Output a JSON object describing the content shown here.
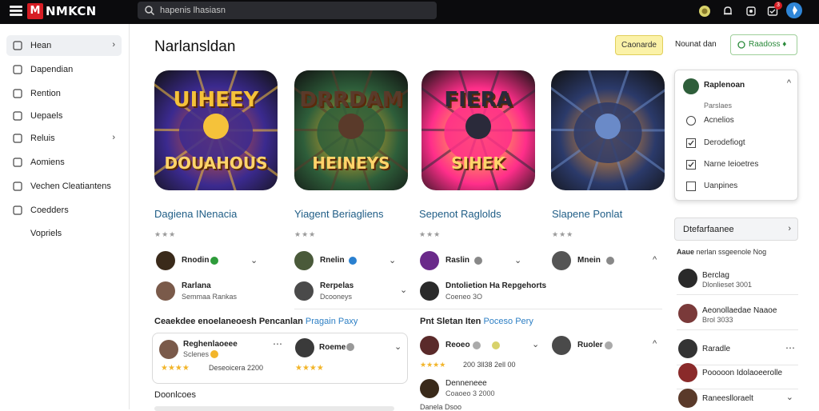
{
  "app": {
    "logo_badge": "M",
    "logo_text": "NMKCN"
  },
  "search": {
    "text": "hapenis lhasiasn"
  },
  "header": {
    "notification_count": "3"
  },
  "sidebar": {
    "items": [
      {
        "label": "Hean",
        "icon": "home-icon",
        "chevron": "›"
      },
      {
        "label": "Dapendian",
        "icon": "calendar-icon",
        "chevron": ""
      },
      {
        "label": "Rention",
        "icon": "person-icon",
        "chevron": ""
      },
      {
        "label": "Uepaels",
        "icon": "grid-icon",
        "chevron": ""
      },
      {
        "label": "Reluis",
        "icon": "document-icon",
        "chevron": "›"
      },
      {
        "label": "Aomiens",
        "icon": "settings-icon",
        "chevron": ""
      },
      {
        "label": "Vechen Cleatiantens",
        "icon": "gear-icon",
        "chevron": ""
      },
      {
        "label": "Coedders",
        "icon": "list-icon",
        "chevron": ""
      },
      {
        "label": "Vopriels",
        "icon": "",
        "chevron": ""
      }
    ]
  },
  "main": {
    "title": "Narlansldan",
    "games": [
      {
        "title": "Dagiena INenacia",
        "stars": "★★★",
        "art_text": "UIHEEY",
        "art_sub": "DOUAHOUS",
        "colors": [
          "#3b2a8f",
          "#e85a2a",
          "#f5c23a"
        ]
      },
      {
        "title": "Yiagent Beriagliens",
        "stars": "★★★",
        "art_text": "DRRDAM",
        "art_sub": "HEINEYS",
        "colors": [
          "#2e5e3a",
          "#f2b52a",
          "#5a3a2a"
        ]
      },
      {
        "title": "Sepenot Raglolds",
        "stars": "★★★",
        "art_text": "FIERA",
        "art_sub": "SIHEK",
        "colors": [
          "#ff2e8a",
          "#ffd93a",
          "#2a2a3a"
        ]
      },
      {
        "title": "Slapene Ponlat",
        "stars": "★★★",
        "art_text": "",
        "art_sub": "",
        "colors": [
          "#2b3a6a",
          "#ff9a2a",
          "#6a8ac8"
        ]
      }
    ],
    "review_rows": [
      {
        "name": "Rnodin",
        "sub": "",
        "avatar": "#3a2a1a",
        "badge": "#2e9b3a"
      },
      {
        "name": "Rnelin",
        "sub": "",
        "avatar": "#4a5a3a",
        "badge": "#2a80d0"
      },
      {
        "name": "Raslin",
        "sub": "",
        "avatar": "#6a2a8a",
        "badge": "#888888"
      },
      {
        "name": "Mnein",
        "sub": "",
        "avatar": "#555555",
        "badge": "#888888"
      }
    ],
    "review_rows_2": [
      {
        "name": "Rarlana",
        "sub": "Semmaa Rankas",
        "avatar": "#7a5a4a"
      },
      {
        "name": "Rerpelas",
        "sub": "Dcooneys",
        "avatar": "#4a4a4a"
      },
      {
        "name": "Dntolietion Ha Repgehorts",
        "sub": "Coeneo 3O",
        "avatar": "#2a2a2a"
      }
    ],
    "section1": {
      "label": "Ceaekdee enoelaneoesh Pencanlan ",
      "link": "Pragain Paxy"
    },
    "section2": {
      "label": "Pnt Sletan Iten ",
      "link": "Poceso Pery"
    },
    "review_card": {
      "name": "Reghenlaoeee",
      "sub": "Sclenes",
      "meta": "Deseoicera 2200",
      "stars": "★★★★"
    },
    "card_row2": [
      {
        "name": "Roeme",
        "sub": "",
        "avatar": "#3a3a3a"
      },
      {
        "name": "Reoeo",
        "sub": "",
        "avatar": "#5a2a2a"
      },
      {
        "name": "Ruoler",
        "sub": "",
        "avatar": "#4a4a4a"
      }
    ],
    "meta_row": {
      "stars": "★★★★",
      "text": "200 3ll38 2ell 00"
    },
    "bottom_left_label": "Doonlcoes",
    "bottom_row": {
      "name": "Denneneee",
      "sub": "Coaoeo 3 2000",
      "avatar": "#3a2a1a"
    },
    "bottom_row2": {
      "text": "Danela Dsoo"
    }
  },
  "actions": {
    "yellow_label": "Caonarde",
    "plain_label": "Nounat dan",
    "green_label": "Raadoss ♦"
  },
  "dropdown": {
    "header": "Raplenoan",
    "sub": "Parslaes",
    "options": [
      {
        "label": "Acnelios",
        "shape": "radio"
      },
      {
        "label": "Derodefiogt",
        "shape": "check"
      },
      {
        "label": "Narne Ieioetres",
        "shape": "check"
      },
      {
        "label": "Uanpines",
        "shape": "box"
      }
    ]
  },
  "filter": {
    "header": "Dtefarfaanee",
    "sub_label": "Aaue",
    "sub_text": "nerlan ssgeenole Nog"
  },
  "right_rows": [
    {
      "name": "Berclag",
      "sub": "Dlonlieset 3001",
      "avatar": "#2a2a2a"
    },
    {
      "name": "Aeonollaedae Naaoe",
      "sub": "Brol 3033",
      "avatar": "#7a3a3a"
    },
    {
      "name": "Raradle",
      "sub": "",
      "avatar": "#333333"
    },
    {
      "name": "Pooooon Idolaoeerolle",
      "sub": "",
      "avatar": "#8a2a2a"
    },
    {
      "name": "Raneeslloraelt",
      "sub": "",
      "avatar": "#5a3a2a"
    }
  ]
}
